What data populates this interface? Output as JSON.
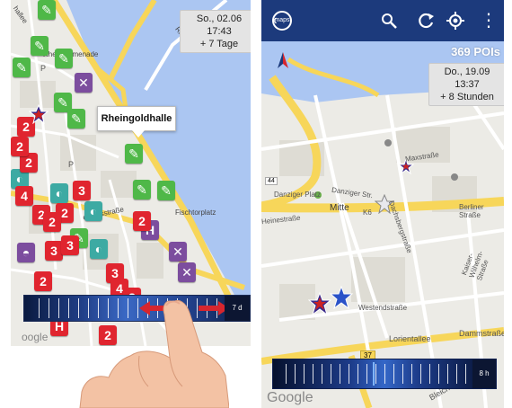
{
  "left_screen": {
    "date_label": {
      "line1": "So., 02.06 17:43",
      "line2": "+ 7 Tage"
    },
    "callout": "Rheingoldhalle",
    "place_labels": {
      "promenade": "Rheinpromenade",
      "hallee": "hallee",
      "rheinufer": "Rheinufer",
      "fischtorplatz": "Fischtorplatz",
      "emtinsstrasse": "emtinsstraße",
      "p": "P"
    },
    "pin_numbers": [
      "2",
      "2",
      "2",
      "4",
      "3",
      "2",
      "2",
      "2",
      "3",
      "2",
      "3",
      "2",
      "3",
      "4",
      "3",
      "2",
      "H",
      "H"
    ],
    "timeline_label": "7 d",
    "google": "oogle"
  },
  "right_screen": {
    "date_label": {
      "line1": "Do., 19.09 13:37",
      "line2": "+ 8 Stunden"
    },
    "pois_count": "369 POIs",
    "app_logo": "maps",
    "streets": {
      "danziger_platz": "Danziger Platz",
      "danziger_str": "Danziger Str.",
      "mitte": "Mitte",
      "maxstrasse": "Maxstraße",
      "berliner": "Berliner Straße",
      "westendstrasse": "Westendstraße",
      "dammstrasse": "Dammstraße",
      "lorientallee": "Lorientallee",
      "route37": "37",
      "route44": "44",
      "k6": "K6",
      "heinestrasse": "Heinestraße",
      "dachsbergstr": "Dachsbergstraße",
      "kaiser": "Kaiser-Wilhelm-Straße",
      "bleich": "Bleich"
    },
    "timeline_label": "8 h",
    "google": "Google"
  },
  "colors": {
    "topbar": "#1c3a7c",
    "river": "#abc6f2",
    "road_yellow": "#f7d65a",
    "pin_red": "#e0252f",
    "pin_green": "#4fb848",
    "pin_purple": "#7c4d9e",
    "pin_teal": "#3daaa3"
  }
}
